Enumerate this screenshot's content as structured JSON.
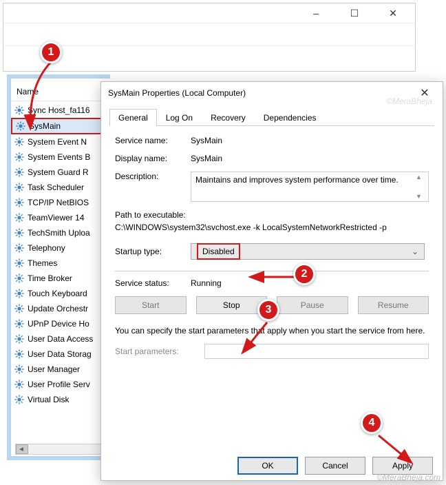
{
  "outer_window": {
    "min_tip": "–",
    "max_tip": "☐",
    "close_tip": "✕"
  },
  "list": {
    "header": "Name",
    "items": [
      "Sync Host_fa116",
      "SysMain",
      "System Event N",
      "System Events B",
      "System Guard R",
      "Task Scheduler",
      "TCP/IP NetBIOS",
      "TeamViewer 14",
      "TechSmith Uploa",
      "Telephony",
      "Themes",
      "Time Broker",
      "Touch Keyboard",
      "Update Orchestr",
      "UPnP Device Ho",
      "User Data Access",
      "User Data Storag",
      "User Manager",
      "User Profile Serv",
      "Virtual Disk"
    ],
    "highlight_index": 1
  },
  "dialog": {
    "title": "SysMain Properties (Local Computer)",
    "close": "✕",
    "tabs": [
      "General",
      "Log On",
      "Recovery",
      "Dependencies"
    ],
    "active_tab": 0,
    "labels": {
      "service_name": "Service name:",
      "display_name": "Display name:",
      "description": "Description:",
      "path_heading": "Path to executable:",
      "startup_type": "Startup type:",
      "service_status": "Service status:",
      "start_params": "Start parameters:"
    },
    "values": {
      "service_name": "SysMain",
      "display_name": "SysMain",
      "description": "Maintains and improves system performance over time.",
      "path": "C:\\WINDOWS\\system32\\svchost.exe -k LocalSystemNetworkRestricted -p",
      "startup_type": "Disabled",
      "service_status": "Running"
    },
    "buttons": {
      "start": "Start",
      "stop": "Stop",
      "pause": "Pause",
      "resume": "Resume"
    },
    "note": "You can specify the start parameters that apply when you start the service from here.",
    "footer": {
      "ok": "OK",
      "cancel": "Cancel",
      "apply": "Apply"
    }
  },
  "annotations": {
    "b1": "1",
    "b2": "2",
    "b3": "3",
    "b4": "4"
  },
  "watermark": "©MeraBheja.com",
  "watermark2": "©MeraBheja"
}
